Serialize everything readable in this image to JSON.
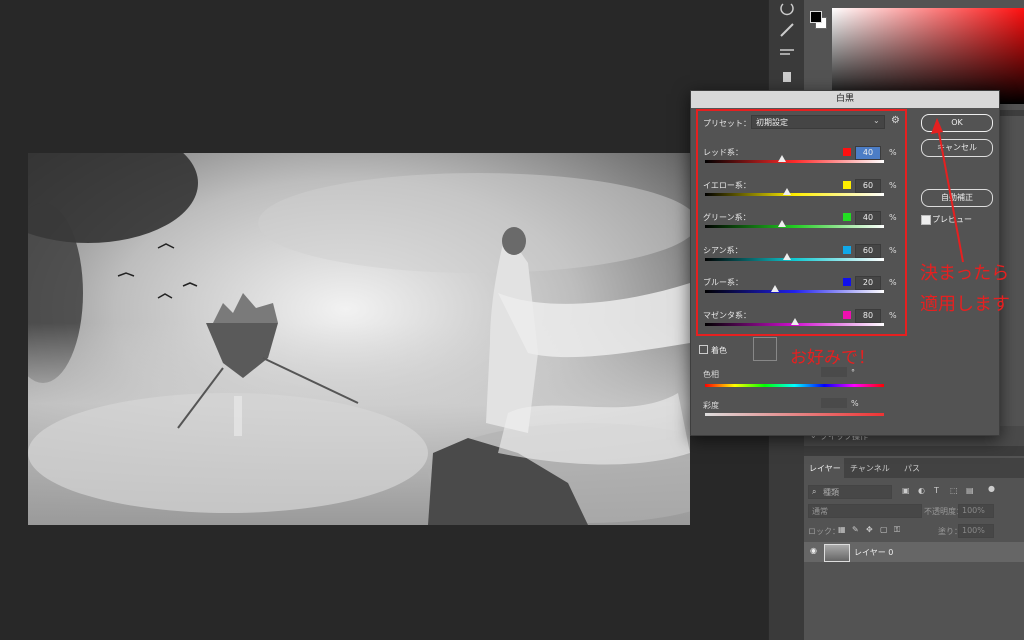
{
  "dialog": {
    "title": "白黒",
    "preset_label": "プリセット：",
    "preset_value": "初期設定",
    "rows": [
      {
        "label": "レッド系：",
        "value": "40",
        "color": "#ff1010",
        "gradient": "linear-gradient(to right,#000,#ff2a2a,#fff)",
        "level": 0.43
      },
      {
        "label": "イエロー系：",
        "value": "60",
        "color": "#ffee00",
        "gradient": "linear-gradient(to right,#000,#ffee00,#fff)",
        "level": 0.46
      },
      {
        "label": "グリーン系：",
        "value": "40",
        "color": "#22dd22",
        "gradient": "linear-gradient(to right,#000,#22cc22,#fff)",
        "level": 0.43
      },
      {
        "label": "シアン系：",
        "value": "60",
        "color": "#10a8e8",
        "gradient": "linear-gradient(to right,#000,#10c8d0,#fff)",
        "level": 0.46
      },
      {
        "label": "ブルー系：",
        "value": "20",
        "color": "#1010ee",
        "gradient": "linear-gradient(to right,#000,#2020ee,#fff)",
        "level": 0.39
      },
      {
        "label": "マゼンタ系：",
        "value": "80",
        "color": "#ee10b0",
        "gradient": "linear-gradient(to right,#000,#d010d0,#fff)",
        "level": 0.5
      }
    ],
    "percent": "%",
    "ok_label": "OK",
    "cancel_label": "キャンセル",
    "auto_label": "自動補正",
    "preview_label": "プレビュー",
    "tint_label": "着色",
    "hue_label": "色相",
    "hue_unit": "°",
    "saturation_label": "彩度",
    "saturation_unit": "%"
  },
  "annotations": {
    "line1": "決まったら",
    "line2": "適用します",
    "preference": "お好みで！"
  },
  "layers": {
    "quick_actions": "クイック操作",
    "tabs": [
      "レイヤー",
      "チャンネル",
      "パス"
    ],
    "filter_placeholder": "種類",
    "blend_mode": "通常",
    "opacity_label": "不透明度：",
    "opacity_value": "100%",
    "lock_label": "ロック：",
    "fill_label": "塗り：",
    "fill_value": "100%",
    "layer_name": "レイヤー 0"
  }
}
